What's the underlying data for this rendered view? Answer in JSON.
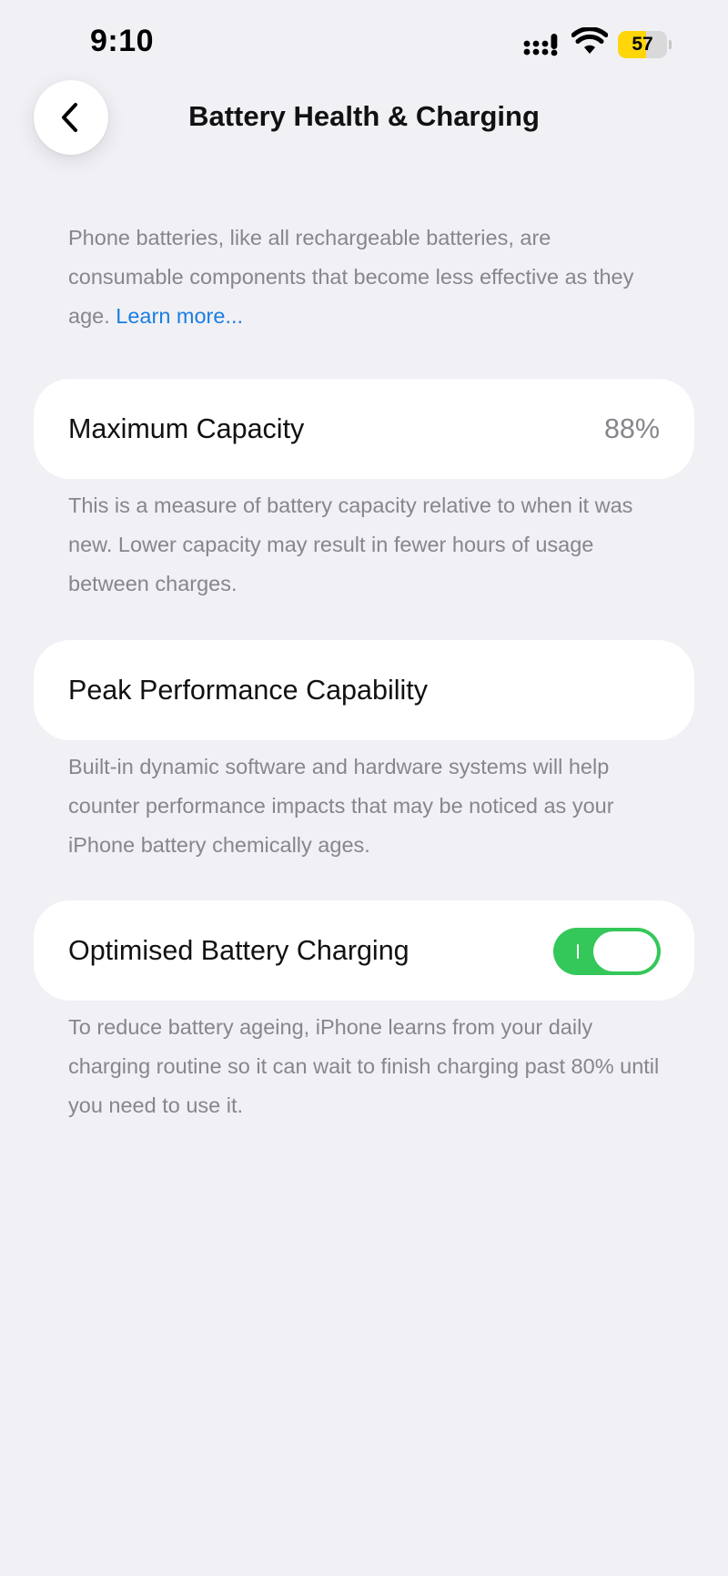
{
  "status_bar": {
    "time": "9:10",
    "battery_level": "57",
    "battery_fraction": 0.57,
    "signal_icon": "signal-bars-icon",
    "wifi_icon": "wifi-icon"
  },
  "nav": {
    "back_icon": "chevron-left-icon",
    "title": "Battery Health & Charging"
  },
  "intro": {
    "text": "Phone batteries, like all rechargeable batteries, are consumable components that become less effective as they age. ",
    "link": "Learn more..."
  },
  "max_capacity": {
    "label": "Maximum Capacity",
    "value": "88%",
    "description": "This is a measure of battery capacity relative to when it was new. Lower capacity may result in fewer hours of usage between charges."
  },
  "peak_performance": {
    "label": "Peak Performance Capability",
    "description": "Built-in dynamic software and hardware systems will help counter performance impacts that may be noticed as your iPhone battery chemically ages."
  },
  "optimised_charging": {
    "label": "Optimised Battery Charging",
    "enabled": true,
    "description": "To reduce battery ageing, iPhone learns from your daily charging routine so it can wait to finish charging past 80% until you need to use it."
  },
  "colors": {
    "background": "#f0f0f5",
    "card": "#ffffff",
    "secondary_text": "#86868b",
    "link": "#1a7ee0",
    "toggle_on": "#34c759",
    "battery_low_power": "#ffd60a"
  }
}
